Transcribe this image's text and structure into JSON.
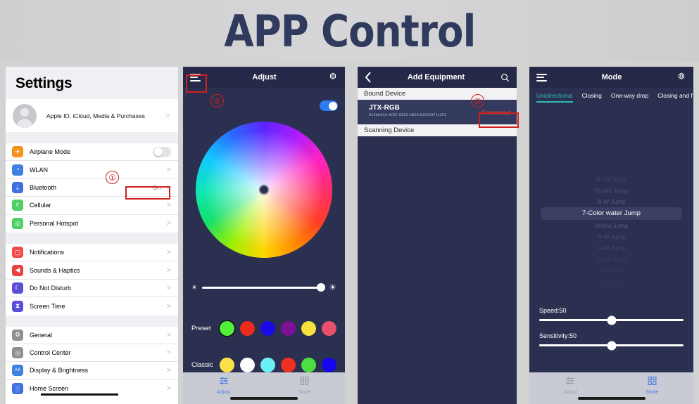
{
  "banner": {
    "title": "APP Control"
  },
  "annotations": [
    {
      "id": "1",
      "label": "①"
    },
    {
      "id": "2",
      "label": "②"
    },
    {
      "id": "3",
      "label": "③"
    }
  ],
  "settings": {
    "title": "Settings",
    "account": {
      "label": "Apple ID, iCloud, Media & Purchases",
      "chevron": ">"
    },
    "group1": [
      {
        "label": "Airplane Mode",
        "icon": "airplane-icon",
        "color": "#f3921f",
        "glyph": "✈",
        "control": "toggle-off"
      },
      {
        "label": "WLAN",
        "icon": "wifi-icon",
        "color": "#3f7fe0",
        "glyph": "◔",
        "control": "chevron",
        "chevron": ">"
      },
      {
        "label": "Bluetooth",
        "icon": "bluetooth-icon",
        "color": "#3f6fe0",
        "glyph": "ᛦ",
        "control": "value",
        "value": "On",
        "chevron": ">"
      },
      {
        "label": "Cellular",
        "icon": "cellular-icon",
        "color": "#4cd062",
        "glyph": "ʕ",
        "control": "chevron",
        "chevron": ">"
      },
      {
        "label": "Personal Hotspot",
        "icon": "hotspot-icon",
        "color": "#4cd062",
        "glyph": "◎",
        "control": "chevron",
        "chevron": ">"
      }
    ],
    "group2": [
      {
        "label": "Notifications",
        "icon": "notifications-icon",
        "color": "#f14a47",
        "glyph": "▢",
        "control": "chevron",
        "chevron": ">"
      },
      {
        "label": "Sounds & Haptics",
        "icon": "sounds-icon",
        "color": "#e8413f",
        "glyph": "◀",
        "control": "chevron",
        "chevron": ">"
      },
      {
        "label": "Do Not Disturb",
        "icon": "moon-icon",
        "color": "#5a4fd6",
        "glyph": "☾",
        "control": "chevron",
        "chevron": ">"
      },
      {
        "label": "Screen Time",
        "icon": "hourglass-icon",
        "color": "#5a4fd6",
        "glyph": "⧗",
        "control": "chevron",
        "chevron": ">"
      }
    ],
    "group3": [
      {
        "label": "General",
        "icon": "gear-icon",
        "color": "#8e8e93",
        "glyph": "⚙",
        "control": "chevron",
        "chevron": ">"
      },
      {
        "label": "Control Center",
        "icon": "control-center-icon",
        "color": "#8e8e93",
        "glyph": "◎",
        "control": "chevron",
        "chevron": ">"
      },
      {
        "label": "Display & Brightness",
        "icon": "display-brightness-icon",
        "color": "#3f7fe0",
        "glyph": "AA",
        "control": "chevron",
        "chevron": ">"
      },
      {
        "label": "Home Screen",
        "icon": "home-screen-icon",
        "color": "#3f6fe0",
        "glyph": "░",
        "control": "chevron",
        "chevron": ">"
      }
    ]
  },
  "adjust": {
    "title": "Adjust",
    "menu_icon": "hamburger-menu-icon",
    "settings_icon": "gear-icon",
    "power_toggle": {
      "name": "power-toggle",
      "state": "on",
      "color": "#2d7df0"
    },
    "color_wheel": {
      "name": "color-wheel",
      "knob": "color-wheel-knob"
    },
    "brightness": {
      "min_icon": "brightness-low-icon",
      "max_icon": "brightness-high-icon",
      "value": 100
    },
    "preset": {
      "label": "Preset",
      "colors": [
        "#52f03a",
        "#ee2a1c",
        "#1a0ae8",
        "#7d1196",
        "#f5e23f",
        "#e8506b"
      ],
      "selected_index": 0
    },
    "classic": {
      "label": "Classic",
      "colors": [
        "#fbe04b",
        "#fdfdfd",
        "#6bf0f5",
        "#ef2f20",
        "#4bdf42",
        "#1406ec"
      ],
      "selected_index": -1
    },
    "tabs": [
      {
        "label": "Adjust",
        "icon": "sliders-icon",
        "active": true
      },
      {
        "label": "Mode",
        "icon": "grid-icon",
        "active": false
      }
    ]
  },
  "equipment": {
    "title": "Add Equipment",
    "back_icon": "back-chevron-icon",
    "search_icon": "search-icon",
    "bound_section": "Bound Device",
    "device": {
      "name": "JTX-RGB",
      "uuid": "B1E6A9CA-6C87-8551-ADE9-E2F259F312F2",
      "status": "Connected",
      "status_color": "#e2574c"
    },
    "scanning_section": "Scanning Device"
  },
  "mode": {
    "title": "Mode",
    "menu_icon": "hamburger-menu-icon",
    "settings_icon": "gear-icon",
    "tabs": [
      {
        "label": "Unidirectional",
        "active": true
      },
      {
        "label": "Closing",
        "active": false
      },
      {
        "label": "One-way drop",
        "active": false
      },
      {
        "label": "Closing and f",
        "active": false
      }
    ],
    "picker": [
      {
        "label": "B->G Jump",
        "selected": false,
        "opacity": 0.32
      },
      {
        "label": "Purple Jump",
        "selected": false,
        "opacity": 0.5
      },
      {
        "label": "B-W Jump",
        "selected": false,
        "opacity": 0.7
      },
      {
        "label": "7-Color water Jump",
        "selected": true,
        "opacity": 1
      },
      {
        "label": "Yellow Jump",
        "selected": false,
        "opacity": 0.7
      },
      {
        "label": "R-W Jump",
        "selected": false,
        "opacity": 0.5
      },
      {
        "label": "G-W Jump",
        "selected": false,
        "opacity": 0.36
      },
      {
        "label": "G->P Jump",
        "selected": false,
        "opacity": 0.24
      },
      {
        "label": "Y->P Jump",
        "selected": false,
        "opacity": 0.14
      },
      {
        "label": "R->W Jump",
        "selected": false,
        "opacity": 0.08
      }
    ],
    "speed": {
      "label": "Speed:50",
      "value": 50
    },
    "sensitivity": {
      "label": "Sensitivity:50",
      "value": 50
    },
    "tabs_bottom": [
      {
        "label": "Adjust",
        "icon": "sliders-icon",
        "active": false
      },
      {
        "label": "Mode",
        "icon": "grid-icon",
        "active": true
      }
    ]
  }
}
